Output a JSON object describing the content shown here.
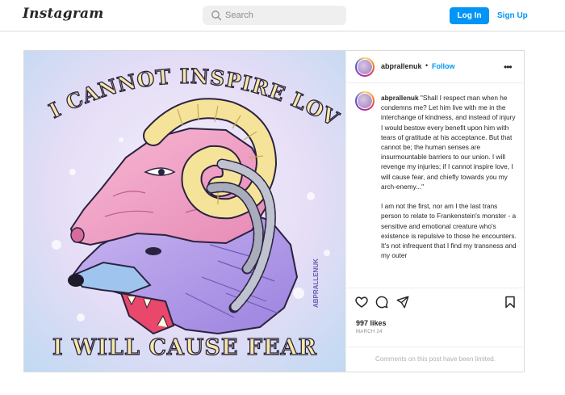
{
  "header": {
    "logo": "Instagram",
    "search": {
      "placeholder": "Search"
    },
    "login_label": "Log In",
    "signup_label": "Sign Up"
  },
  "post": {
    "artwork": {
      "top_text": "IF I CANNOT INSPIRE LOVE",
      "bottom_text": "I WILL CAUSE FEAR",
      "signature": "ABPRALLENUK"
    },
    "author": "abprallenuk",
    "dot": "•",
    "follow_label": "Follow",
    "more_label": "•••",
    "caption_user": "abprallenuk",
    "caption_p1": " \"Shall I respect man when he condemns me? Let him live with me in the interchange of kindness, and instead of injury I would bestow every benefit upon him with tears of gratitude at his acceptance. But that cannot be; the human senses are insurmountable barriers to our union. I will revenge my injuries; if I cannot inspire love, I will cause fear, and chiefly towards you my arch-enemy...\"",
    "caption_p2": "I am not the first, nor am I the last trans person to relate to Frankenstein's monster - a sensitive and emotional creature who's existence is repulsive to those he encounters. It's not infrequent that I find my transness and my outer",
    "likes": "997 likes",
    "date": "MARCH 24",
    "comments_limited": "Comments on this post have been limited."
  },
  "colors": {
    "accent": "#0095f6",
    "border": "#dbdbdb"
  }
}
